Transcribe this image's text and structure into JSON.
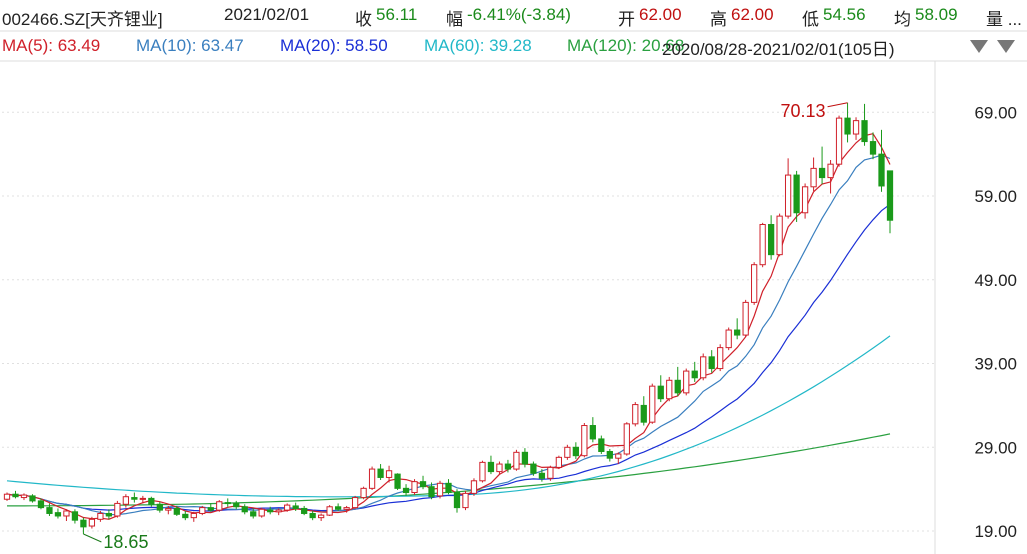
{
  "header": {
    "code": "002466.SZ[天齐锂业]",
    "date": "2021/02/01",
    "close_label": "收",
    "close": "56.11",
    "change_label": "幅",
    "change": "-6.41%(-3.84)",
    "open_label": "开",
    "open": "62.00",
    "high_label": "高",
    "high": "62.00",
    "low_label": "低",
    "low": "54.56",
    "avg_label": "均",
    "avg": "58.09",
    "vol_label": "量 ..."
  },
  "ma_legend": [
    {
      "label": "MA(5): 63.49",
      "color": "#d0202a"
    },
    {
      "label": "MA(10): 63.47",
      "color": "#3a7fbf"
    },
    {
      "label": "MA(20): 58.50",
      "color": "#1a2fd6"
    },
    {
      "label": "MA(60): 39.28",
      "color": "#22b8c8"
    },
    {
      "label": "MA(120): 20.68",
      "color": "#2aa040"
    }
  ],
  "range_label": "2020/08/28-2021/02/01(105日)",
  "colors": {
    "up": "#d0202a",
    "down": "#1a9a1a",
    "grid": "#e0e0e0",
    "label_max": "#c01010",
    "label_min": "#1a7a1a"
  },
  "chart_data": {
    "type": "candlestick",
    "ylim": [
      16.5,
      75
    ],
    "yticks": [
      "19.00",
      "29.00",
      "39.00",
      "49.00",
      "59.00",
      "69.00"
    ],
    "ytick_values": [
      19,
      29,
      39,
      49,
      59,
      69
    ],
    "max_label": "70.13",
    "min_label": "18.65",
    "candles": [
      [
        22.8,
        23.6,
        22.6,
        23.4
      ],
      [
        23.4,
        23.8,
        22.9,
        23.1
      ],
      [
        23.0,
        23.5,
        22.7,
        23.3
      ],
      [
        23.2,
        23.4,
        22.4,
        22.6
      ],
      [
        22.6,
        22.9,
        21.6,
        21.8
      ],
      [
        21.8,
        22.3,
        20.8,
        21.1
      ],
      [
        21.2,
        21.7,
        20.5,
        20.8
      ],
      [
        20.8,
        21.6,
        20.2,
        21.4
      ],
      [
        21.3,
        21.6,
        19.9,
        20.3
      ],
      [
        20.3,
        20.6,
        18.65,
        19.5
      ],
      [
        19.6,
        20.7,
        19.3,
        20.4
      ],
      [
        20.4,
        21.4,
        20.1,
        21.1
      ],
      [
        21.1,
        21.6,
        20.4,
        20.8
      ],
      [
        20.8,
        22.6,
        20.6,
        22.3
      ],
      [
        22.2,
        23.4,
        21.8,
        23.1
      ],
      [
        23.0,
        23.6,
        22.4,
        22.8
      ],
      [
        22.8,
        23.2,
        22.3,
        22.9
      ],
      [
        22.9,
        23.1,
        21.9,
        22.2
      ],
      [
        22.2,
        22.5,
        21.2,
        21.5
      ],
      [
        21.5,
        22.0,
        21.0,
        21.7
      ],
      [
        21.7,
        22.0,
        20.8,
        21.0
      ],
      [
        21.0,
        21.4,
        20.3,
        20.6
      ],
      [
        20.6,
        21.3,
        20.1,
        21.1
      ],
      [
        21.1,
        22.0,
        20.9,
        21.8
      ],
      [
        21.8,
        22.3,
        21.3,
        21.5
      ],
      [
        21.5,
        22.7,
        21.3,
        22.5
      ],
      [
        22.4,
        22.9,
        21.9,
        22.3
      ],
      [
        22.3,
        22.6,
        21.6,
        21.9
      ],
      [
        21.9,
        22.2,
        21.0,
        21.3
      ],
      [
        21.3,
        21.7,
        20.5,
        20.8
      ],
      [
        20.8,
        21.8,
        20.6,
        21.6
      ],
      [
        21.5,
        21.9,
        21.0,
        21.3
      ],
      [
        21.3,
        21.7,
        20.9,
        21.5
      ],
      [
        21.5,
        22.3,
        21.3,
        22.1
      ],
      [
        22.0,
        22.4,
        21.4,
        21.7
      ],
      [
        21.7,
        22.0,
        20.9,
        21.1
      ],
      [
        21.1,
        21.4,
        20.3,
        20.6
      ],
      [
        20.6,
        21.1,
        20.2,
        20.9
      ],
      [
        20.9,
        22.1,
        20.8,
        21.9
      ],
      [
        21.9,
        22.3,
        21.4,
        21.6
      ],
      [
        21.6,
        22.0,
        21.2,
        21.8
      ],
      [
        21.8,
        23.2,
        21.6,
        23.0
      ],
      [
        23.0,
        24.3,
        22.8,
        24.1
      ],
      [
        24.1,
        26.7,
        23.9,
        26.4
      ],
      [
        26.4,
        27.0,
        25.1,
        25.4
      ],
      [
        25.4,
        26.8,
        24.8,
        26.2
      ],
      [
        25.8,
        25.9,
        23.9,
        24.1
      ],
      [
        24.1,
        24.6,
        23.2,
        23.6
      ],
      [
        23.6,
        25.2,
        23.3,
        24.9
      ],
      [
        24.9,
        25.6,
        24.0,
        24.3
      ],
      [
        24.3,
        24.8,
        22.8,
        23.1
      ],
      [
        23.2,
        25.0,
        22.9,
        24.7
      ],
      [
        24.7,
        25.2,
        23.4,
        23.6
      ],
      [
        23.6,
        24.0,
        21.2,
        21.8
      ],
      [
        21.8,
        23.8,
        21.5,
        23.5
      ],
      [
        23.5,
        25.3,
        23.2,
        25.0
      ],
      [
        25.0,
        27.4,
        24.8,
        27.2
      ],
      [
        27.2,
        28.0,
        25.8,
        26.1
      ],
      [
        26.1,
        27.3,
        25.8,
        27.0
      ],
      [
        27.0,
        27.5,
        26.0,
        26.4
      ],
      [
        26.4,
        28.7,
        26.2,
        28.4
      ],
      [
        28.4,
        28.9,
        26.6,
        27.0
      ],
      [
        27.0,
        27.3,
        25.6,
        25.9
      ],
      [
        25.9,
        26.4,
        24.9,
        25.3
      ],
      [
        25.3,
        26.8,
        25.0,
        26.6
      ],
      [
        26.6,
        28.0,
        26.4,
        27.8
      ],
      [
        27.8,
        29.3,
        27.5,
        29.0
      ],
      [
        29.0,
        29.6,
        27.6,
        28.0
      ],
      [
        28.0,
        31.9,
        27.8,
        31.6
      ],
      [
        31.6,
        32.6,
        29.6,
        30.0
      ],
      [
        30.0,
        30.4,
        28.2,
        28.5
      ],
      [
        28.5,
        28.8,
        27.3,
        27.7
      ],
      [
        27.7,
        28.4,
        27.0,
        28.2
      ],
      [
        28.2,
        32.0,
        28.0,
        31.8
      ],
      [
        31.8,
        34.4,
        31.5,
        34.1
      ],
      [
        34.0,
        35.1,
        31.6,
        32.0
      ],
      [
        32.0,
        36.6,
        31.8,
        36.3
      ],
      [
        36.3,
        37.6,
        34.4,
        34.8
      ],
      [
        34.8,
        37.4,
        34.5,
        37.0
      ],
      [
        37.0,
        38.6,
        35.1,
        35.5
      ],
      [
        35.5,
        38.4,
        35.2,
        38.1
      ],
      [
        38.1,
        39.2,
        36.8,
        37.3
      ],
      [
        37.3,
        40.2,
        37.0,
        39.8
      ],
      [
        39.8,
        40.6,
        37.9,
        38.4
      ],
      [
        38.4,
        41.3,
        38.1,
        40.9
      ],
      [
        40.9,
        43.3,
        40.6,
        43.0
      ],
      [
        43.0,
        44.4,
        41.9,
        42.4
      ],
      [
        42.4,
        46.6,
        42.2,
        46.3
      ],
      [
        46.3,
        51.1,
        46.0,
        50.8
      ],
      [
        50.8,
        55.8,
        50.5,
        55.6
      ],
      [
        55.6,
        56.7,
        51.4,
        52.0
      ],
      [
        52.0,
        56.9,
        51.8,
        56.6
      ],
      [
        56.6,
        63.5,
        56.3,
        61.5
      ],
      [
        61.5,
        62.0,
        55.9,
        57.0
      ],
      [
        57.0,
        60.5,
        56.3,
        60.1
      ],
      [
        60.1,
        63.6,
        59.6,
        62.3
      ],
      [
        62.3,
        64.9,
        60.4,
        61.2
      ],
      [
        61.2,
        63.3,
        59.3,
        62.8
      ],
      [
        62.8,
        68.6,
        62.5,
        68.3
      ],
      [
        68.3,
        70.13,
        65.4,
        66.4
      ],
      [
        66.4,
        68.4,
        65.7,
        68.0
      ],
      [
        68.0,
        70.0,
        65.0,
        65.5
      ],
      [
        65.5,
        66.6,
        63.4,
        64.0
      ],
      [
        64.0,
        66.9,
        59.5,
        60.2
      ],
      [
        62.0,
        62.0,
        54.56,
        56.11
      ]
    ]
  }
}
